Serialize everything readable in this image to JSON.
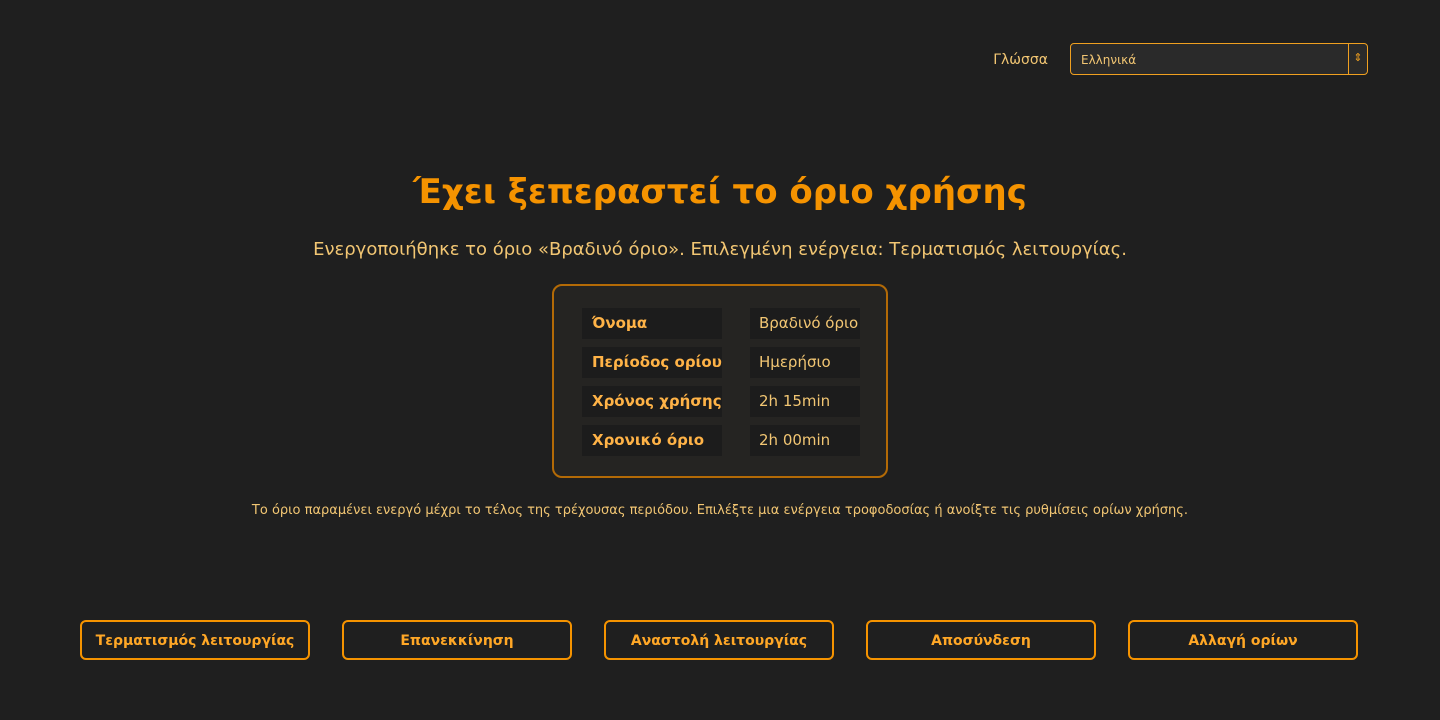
{
  "language": {
    "label": "Γλώσσα",
    "selected": "Ελληνικά",
    "arrow_icon": "sort-arrows-icon"
  },
  "title": "Έχει ξεπεραστεί το όριο χρήσης",
  "subtitle": "Ενεργοποιήθηκε το όριο «Βραδινό όριο». Επιλεγμένη ενέργεια: Τερματισμός λειτουργίας.",
  "details": [
    {
      "key": "Όνομα",
      "value": "Βραδινό όριο"
    },
    {
      "key": "Περίοδος ορίου",
      "value": "Ημερήσιο"
    },
    {
      "key": "Χρόνος χρήσης",
      "value": "2h 15min"
    },
    {
      "key": "Χρονικό όριο",
      "value": "2h 00min"
    }
  ],
  "note": "Το όριο παραμένει ενεργό μέχρι το τέλος της τρέχουσας περιόδου. Επιλέξτε μια ενέργεια τροφοδοσίας ή ανοίξτε τις ρυθμίσεις ορίων χρήσης.",
  "actions": [
    {
      "label": "Τερματισμός λειτουργίας"
    },
    {
      "label": "Επανεκκίνηση"
    },
    {
      "label": "Αναστολή λειτουργίας"
    },
    {
      "label": "Αποσύνδεση"
    },
    {
      "label": "Αλλαγή ορίων"
    }
  ],
  "colors": {
    "background": "#1f1f1f",
    "accent": "#f59300",
    "text": "#f2c673",
    "key_text": "#ffb347"
  }
}
